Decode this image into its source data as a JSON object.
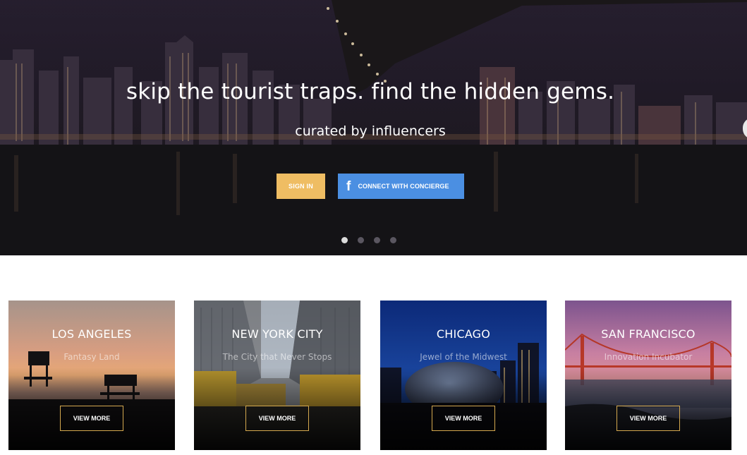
{
  "hero": {
    "headline": "skip the tourist traps. find the hidden gems.",
    "subheadline": "curated by influencers",
    "signin_label": "SIGN IN",
    "facebook_icon": "f",
    "connect_label": "CONNECT WITH CONCIERGE",
    "slides_total": 4,
    "slide_active": 1
  },
  "colors": {
    "signin": "#efbd63",
    "facebook": "#4b8fe2",
    "card_button_border": "#d5a94f"
  },
  "cities": [
    {
      "name": "LOS ANGELES",
      "tagline": "Fantasy Land",
      "button": "VIEW MORE"
    },
    {
      "name": "NEW YORK CITY",
      "tagline": "The City that Never Stops",
      "button": "VIEW MORE"
    },
    {
      "name": "CHICAGO",
      "tagline": "Jewel of the Midwest",
      "button": "VIEW MORE"
    },
    {
      "name": "SAN FRANCISCO",
      "tagline": "Innovation Incubator",
      "button": "VIEW MORE"
    }
  ]
}
